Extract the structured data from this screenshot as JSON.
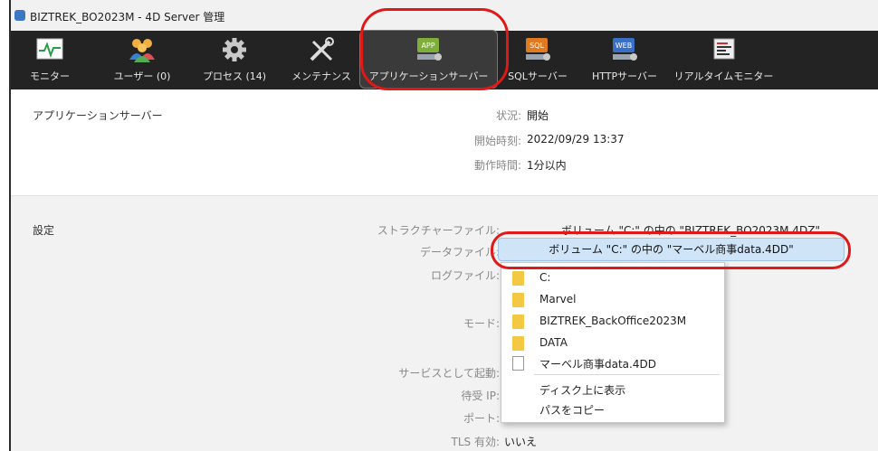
{
  "window": {
    "title": "BIZTREK_BO2023M - 4D Server 管理"
  },
  "toolbar": {
    "items": [
      {
        "label": "モニター",
        "icon": "monitor-icon"
      },
      {
        "label": "ユーザー (0)",
        "icon": "users-icon"
      },
      {
        "label": "プロセス (14)",
        "icon": "gear-icon"
      },
      {
        "label": "メンテナンス",
        "icon": "tools-icon"
      },
      {
        "label": "アプリケーションサーバー",
        "icon": "app-server-icon",
        "badge": "APP",
        "active": true
      },
      {
        "label": "SQLサーバー",
        "icon": "sql-server-icon",
        "badge": "SQL"
      },
      {
        "label": "HTTPサーバー",
        "icon": "http-server-icon",
        "badge": "WEB"
      },
      {
        "label": "リアルタイムモニター",
        "icon": "realtime-monitor-icon"
      }
    ]
  },
  "status": {
    "section_label": "アプリケーションサーバー",
    "state_key": "状況:",
    "state_value": "開始",
    "start_key": "開始時刻:",
    "start_value": "2022/09/29  13:37",
    "uptime_key": "動作時間:",
    "uptime_value": "1分以内"
  },
  "settings": {
    "section_label": "設定",
    "structure_key": "ストラクチャーファイル:",
    "structure_value": "ボリューム \"C:\" の中の \"BIZTREK_BO2023M.4DZ\"",
    "data_key": "データファイル:",
    "data_value": "ボリューム \"C:\" の中の \"マーベル商事data.4DD\"",
    "log_key": "ログファイル:",
    "mode_key": "モード:",
    "service_key": "サービスとして起動:",
    "ip_key": "待受 IP:",
    "port_key": "ポート:",
    "tls_key": "TLS 有効:",
    "tls_value": "いいえ"
  },
  "path_menu": {
    "items": [
      {
        "label": "C:",
        "icon": "folder-icon"
      },
      {
        "label": "Marvel",
        "icon": "folder-icon"
      },
      {
        "label": "BIZTREK_BackOffice2023M",
        "icon": "folder-icon"
      },
      {
        "label": "DATA",
        "icon": "folder-icon"
      },
      {
        "label": "マーベル商事data.4DD",
        "icon": "file-icon"
      }
    ],
    "actions": [
      {
        "label": "ディスク上に表示"
      },
      {
        "label": "パスをコピー"
      }
    ]
  },
  "colors": {
    "highlight": "#e01818",
    "toolbar_bg": "#232323",
    "selection": "#cfe4f7"
  }
}
